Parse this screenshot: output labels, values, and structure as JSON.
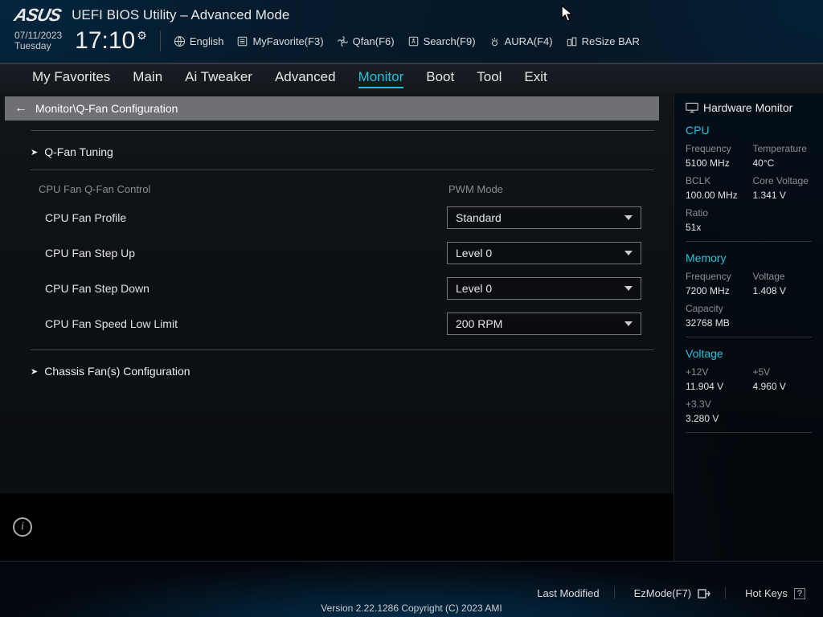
{
  "header": {
    "brand": "ASUS",
    "title": "UEFI BIOS Utility – Advanced Mode",
    "date": "07/11/2023",
    "day": "Tuesday",
    "time": "17:10"
  },
  "toolbar": {
    "language": "English",
    "myfav": "MyFavorite(F3)",
    "qfan": "Qfan(F6)",
    "search": "Search(F9)",
    "aura": "AURA(F4)",
    "resize": "ReSize BAR"
  },
  "tabs": [
    "My Favorites",
    "Main",
    "Ai Tweaker",
    "Advanced",
    "Monitor",
    "Boot",
    "Tool",
    "Exit"
  ],
  "activeTab": "Monitor",
  "breadcrumb": "Monitor\\Q-Fan Configuration",
  "settings": {
    "qfan_tuning": "Q-Fan Tuning",
    "section_label": "CPU Fan Q-Fan Control",
    "section_val": "PWM Mode",
    "rows": [
      {
        "label": "CPU Fan Profile",
        "value": "Standard"
      },
      {
        "label": "CPU Fan Step Up",
        "value": "Level 0"
      },
      {
        "label": "CPU Fan Step Down",
        "value": "Level 0"
      },
      {
        "label": "CPU Fan Speed Low Limit",
        "value": "200 RPM"
      }
    ],
    "chassis": "Chassis Fan(s) Configuration"
  },
  "hw": {
    "title": "Hardware Monitor",
    "cpu": {
      "heading": "CPU",
      "freq_k": "Frequency",
      "freq_v": "5100 MHz",
      "temp_k": "Temperature",
      "temp_v": "40°C",
      "bclk_k": "BCLK",
      "bclk_v": "100.00 MHz",
      "cv_k": "Core Voltage",
      "cv_v": "1.341 V",
      "ratio_k": "Ratio",
      "ratio_v": "51x"
    },
    "mem": {
      "heading": "Memory",
      "freq_k": "Frequency",
      "freq_v": "7200 MHz",
      "volt_k": "Voltage",
      "volt_v": "1.408 V",
      "cap_k": "Capacity",
      "cap_v": "32768 MB"
    },
    "volt": {
      "heading": "Voltage",
      "v12_k": "+12V",
      "v12_v": "11.904 V",
      "v5_k": "+5V",
      "v5_v": "4.960 V",
      "v33_k": "+3.3V",
      "v33_v": "3.280 V"
    }
  },
  "footer": {
    "last": "Last Modified",
    "ez": "EzMode(F7)",
    "hot": "Hot Keys",
    "ver": "Version 2.22.1286 Copyright (C) 2023 AMI"
  }
}
